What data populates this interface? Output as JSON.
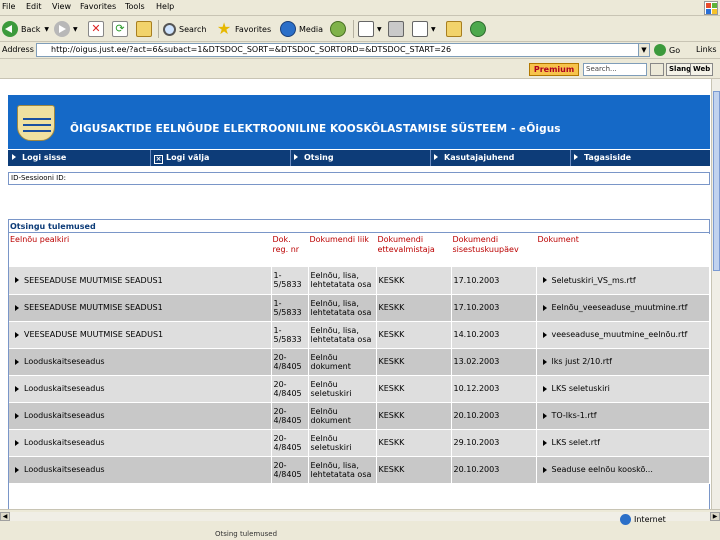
{
  "menu": [
    "File",
    "Edit",
    "View",
    "Favorites",
    "Tools",
    "Help"
  ],
  "toolbar": {
    "back": "Back",
    "search": "Search",
    "favorites": "Favorites",
    "media": "Media"
  },
  "address": {
    "label": "Address",
    "url": "http://oigus.just.ee/?act=6&subact=1&DTSDOC_SORT=&DTSDOC_SORTORD=&DTSDOC_START=26",
    "go": "Go",
    "links": "Links"
  },
  "search_toolbar": {
    "premium": "Premium",
    "placeholder": "Search...",
    "lang": "Slang",
    "web": "Web"
  },
  "page": {
    "banner_title": "ÕIGUSAKTIDE EELNÕUDE ELEKTROONILINE KOOSKÕLASTAMISE SÜSTEEM - eÕigus",
    "nav": [
      "Logi sisse",
      "Logi välja",
      "Otsing",
      "Kasutajajuhend",
      "Tagasiside"
    ],
    "session_label": "ID-Sessiooni ID:",
    "results_title": "Otsingu tulemused",
    "columns": [
      "Eelnõu pealkiri",
      "Dok. reg. nr",
      "Dokumendi liik",
      "Dokumendi ettevalmistaja",
      "Dokumendi sisestuskuupäev",
      "Dokument"
    ],
    "rows": [
      {
        "title": "SEESEADUSE MUUTMISE SEADUS1",
        "reg": "1-5/5833",
        "type": "Eelnõu, lisa, lehtetatata osa",
        "prep": "KESKK",
        "date": "17.10.2003",
        "doc": "Seletuskiri_VS_ms.rtf"
      },
      {
        "title": "SEESEADUSE MUUTMISE SEADUS1",
        "reg": "1-5/5833",
        "type": "Eelnõu, lisa, lehtetatata osa",
        "prep": "KESKK",
        "date": "17.10.2003",
        "doc": "Eelnõu_veeseaduse_muutmine.rtf"
      },
      {
        "title": "VEESEADUSE MUUTMISE SEADUS1",
        "reg": "1-5/5833",
        "type": "Eelnõu, lisa, lehtetatata osa",
        "prep": "KESKK",
        "date": "14.10.2003",
        "doc": "veeseaduse_muutmine_eelnõu.rtf"
      },
      {
        "title": "Looduskaitseseadus",
        "reg": "20-4/8405",
        "type": "Eelnõu dokument",
        "prep": "KESKK",
        "date": "13.02.2003",
        "doc": "lks just 2/10.rtf"
      },
      {
        "title": "Looduskaitseseadus",
        "reg": "20-4/8405",
        "type": "Eelnõu seletuskiri",
        "prep": "KESKK",
        "date": "10.12.2003",
        "doc": "LKS seletuskiri"
      },
      {
        "title": "Looduskaitseseadus",
        "reg": "20-4/8405",
        "type": "Eelnõu dokument",
        "prep": "KESKK",
        "date": "20.10.2003",
        "doc": "TO-lks-1.rtf"
      },
      {
        "title": "Looduskaitseseadus",
        "reg": "20-4/8405",
        "type": "Eelnõu seletuskiri",
        "prep": "KESKK",
        "date": "29.10.2003",
        "doc": "LKS selet.rtf"
      },
      {
        "title": "Looduskaitseseadus",
        "reg": "20-4/8405",
        "type": "Eelnõu, lisa, lehtetatata osa",
        "prep": "KESKK",
        "date": "20.10.2003",
        "doc": "Seaduse eelnõu kooskõ..."
      }
    ]
  },
  "status": {
    "zone": "Internet",
    "below": "Otsing tulemused"
  },
  "colors": {
    "banner": "#1569c7",
    "nav": "#0d3c78",
    "header_text": "#b00000"
  }
}
